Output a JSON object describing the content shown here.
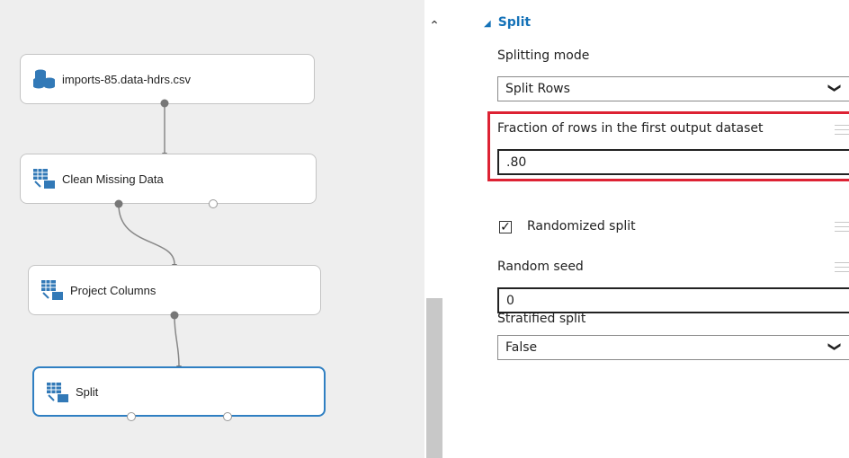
{
  "canvas": {
    "modules": [
      {
        "id": "dataset",
        "label": "imports-85.data-hdrs.csv",
        "icon": "dataset-icon"
      },
      {
        "id": "clean",
        "label": "Clean Missing Data",
        "icon": "module-grid-icon"
      },
      {
        "id": "project",
        "label": "Project Columns",
        "icon": "module-grid-icon"
      },
      {
        "id": "split",
        "label": "Split",
        "icon": "module-grid-icon",
        "selected": true
      }
    ]
  },
  "scrollbar": {
    "up_icon": "chevron-up-icon"
  },
  "properties": {
    "section_title": "Split",
    "splitting_mode": {
      "label": "Splitting mode",
      "value": "Split Rows"
    },
    "fraction": {
      "label": "Fraction of rows in the first output dataset",
      "value": ".80"
    },
    "randomized": {
      "label": "Randomized split",
      "checked": true
    },
    "random_seed": {
      "label": "Random seed",
      "value": "0"
    },
    "stratified": {
      "label": "Stratified split",
      "value": "False"
    }
  },
  "colors": {
    "accent": "#1572b8",
    "highlight": "#dd2233",
    "selected_border": "#2f7fc2"
  }
}
